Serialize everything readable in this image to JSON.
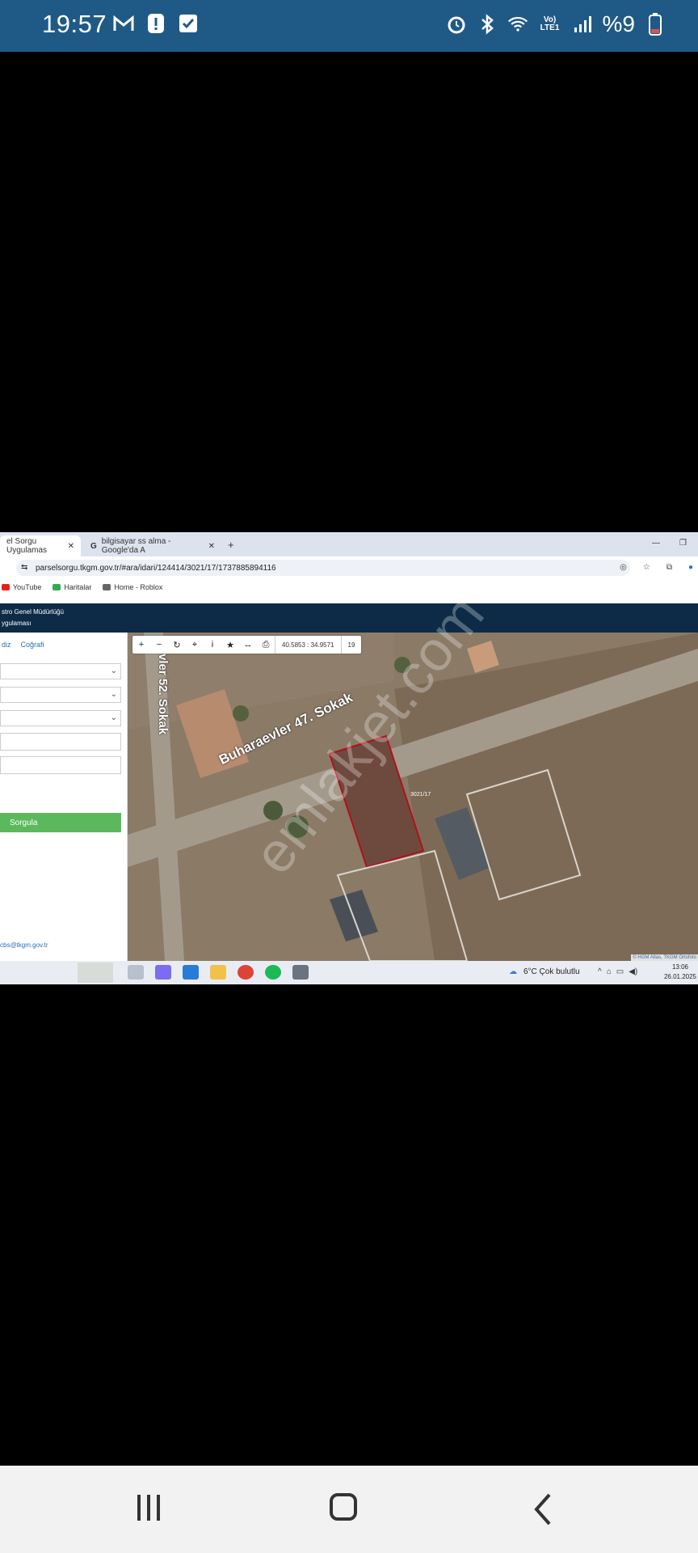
{
  "status_bar": {
    "time": "19:57",
    "battery_text": "%9",
    "icons": [
      "gmail-icon",
      "alert-icon",
      "check-icon",
      "alarm-icon",
      "bluetooth-icon",
      "wifi-icon",
      "volte-icon",
      "signal-icon",
      "battery-icon"
    ]
  },
  "browser": {
    "tabs": [
      {
        "label": "el Sorgu Uygulamas"
      },
      {
        "label": "bilgisayar ss alma - Google'da A"
      }
    ],
    "new_tab": "+",
    "url": "parselsorgu.tkgm.gov.tr/#ara/idari/124414/3021/17/1737885894116",
    "bookmarks": [
      {
        "label": "YouTube",
        "color": "#e62117"
      },
      {
        "label": "Haritalar",
        "color": "#34a853"
      },
      {
        "label": "Home - Roblox",
        "color": "#666666"
      }
    ]
  },
  "site": {
    "header_line1": "stro Genel Müdürlüğü",
    "header_line2": "ygulaması",
    "panel_tabs": [
      "diz",
      "Coğrafi"
    ],
    "query_button": "Sorgula",
    "email": "cbs@tkgm.gov.tr"
  },
  "map": {
    "coords": "40.5853 : 34.9571",
    "zoom": "19",
    "street1": "Buharaevler 47. Sokak",
    "street2": "vler 52. Sokak",
    "parcel_label": "3021/17",
    "attribution": "© HGM Atlas, TKGM Ortofoto",
    "watermark": "emlakjet.com"
  },
  "taskbar": {
    "weather": "6°C  Çok bulutlu",
    "time": "13:06",
    "date": "26.01.2025"
  }
}
